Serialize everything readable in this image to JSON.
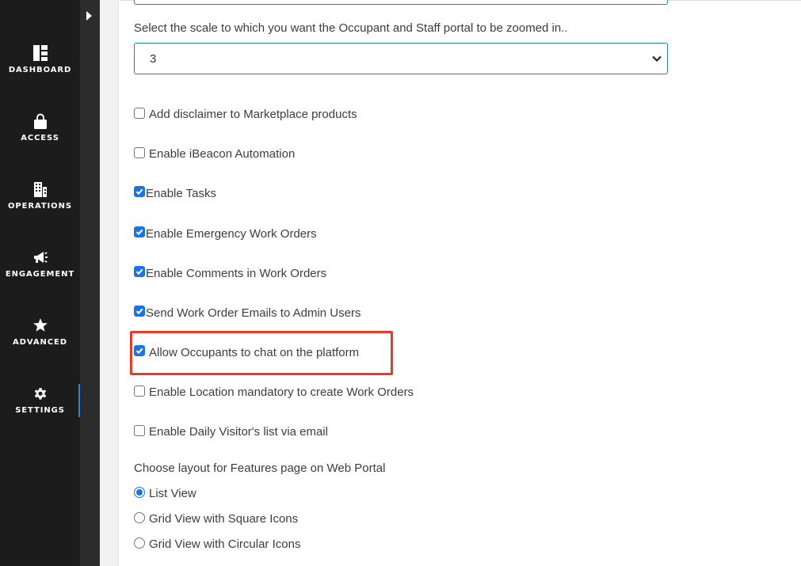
{
  "sidebar": {
    "items": [
      {
        "label": "DASHBOARD",
        "icon": "dashboard-icon"
      },
      {
        "label": "ACCESS",
        "icon": "lock-icon"
      },
      {
        "label": "OPERATIONS",
        "icon": "building-icon"
      },
      {
        "label": "ENGAGEMENT",
        "icon": "megaphone-icon"
      },
      {
        "label": "ADVANCED",
        "icon": "star-icon"
      },
      {
        "label": "SETTINGS",
        "icon": "gear-icon",
        "active": true
      }
    ],
    "accent_color": "#2f7fe0"
  },
  "zoom": {
    "label": "Select the scale to which you want the Occupant and Staff portal to be zoomed in..",
    "value": "3"
  },
  "options": [
    {
      "label": "Add disclaimer to Marketplace products",
      "checked": false
    },
    {
      "label": "Enable iBeacon Automation",
      "checked": false
    },
    {
      "label": "Enable Tasks",
      "checked": true
    },
    {
      "label": "Enable Emergency Work Orders",
      "checked": true
    },
    {
      "label": "Enable Comments in Work Orders",
      "checked": true
    },
    {
      "label": "Send Work Order Emails to Admin Users",
      "checked": true
    },
    {
      "label": "Allow Occupants to chat on the platform",
      "checked": true,
      "highlighted": true
    },
    {
      "label": "Enable Location mandatory to create Work Orders",
      "checked": false
    },
    {
      "label": "Enable Daily Visitor's list via email",
      "checked": false
    }
  ],
  "layout": {
    "label": "Choose layout for Features page on Web Portal",
    "choices": [
      {
        "label": "List View",
        "selected": true
      },
      {
        "label": "Grid View with Square Icons",
        "selected": false
      },
      {
        "label": "Grid View with Circular Icons",
        "selected": false
      }
    ]
  },
  "highlight_color": "#e8392a",
  "checkbox_color": "#1a73e8"
}
